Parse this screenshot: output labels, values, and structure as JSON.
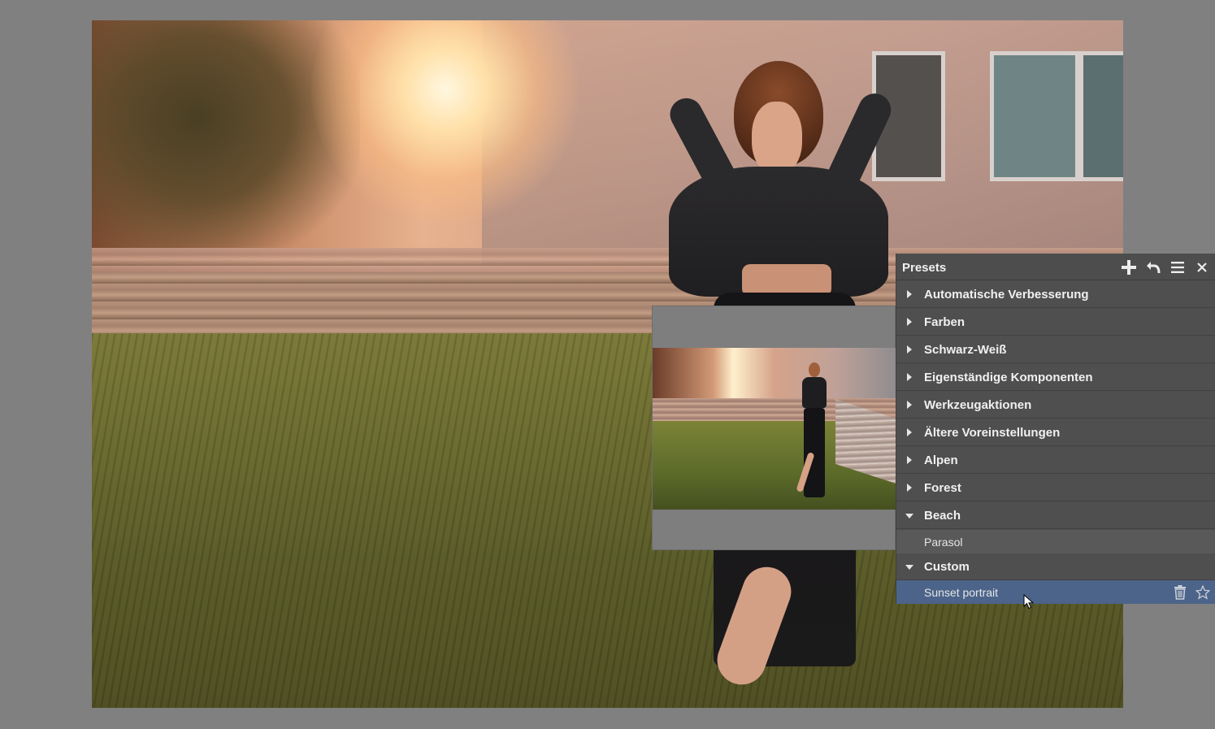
{
  "presets_panel": {
    "title": "Presets",
    "header_actions": [
      "plus-icon",
      "undo-icon",
      "menu-icon",
      "close-icon"
    ],
    "categories": [
      {
        "label": "Automatische Verbesserung",
        "expanded": false
      },
      {
        "label": "Farben",
        "expanded": false
      },
      {
        "label": "Schwarz-Weiß",
        "expanded": false
      },
      {
        "label": "Eigenständige Komponenten",
        "expanded": false
      },
      {
        "label": "Werkzeugaktionen",
        "expanded": false
      },
      {
        "label": "Ältere Voreinstellungen",
        "expanded": false
      },
      {
        "label": "Alpen",
        "expanded": false
      },
      {
        "label": "Forest",
        "expanded": false
      },
      {
        "label": "Beach",
        "expanded": true,
        "items": [
          {
            "label": "Parasol"
          }
        ]
      },
      {
        "label": "Custom",
        "expanded": true,
        "items": [
          {
            "label": "Sunset portrait",
            "selected": true,
            "actions": [
              "trash-icon",
              "star-icon"
            ]
          }
        ]
      }
    ],
    "selected_color": "#4c6489"
  },
  "colors": {
    "app_background": "#808080",
    "panel_background": "#4e4e4e"
  }
}
